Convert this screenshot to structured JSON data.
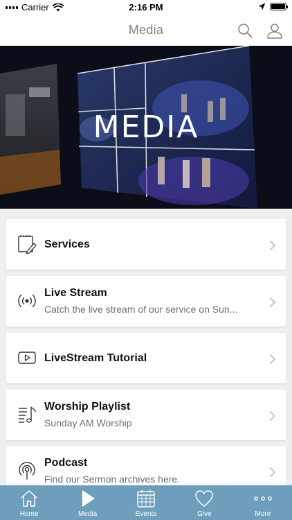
{
  "status_bar": {
    "carrier": "Carrier",
    "time": "2:16 PM"
  },
  "nav": {
    "title": "Media"
  },
  "hero": {
    "title": "MEDIA"
  },
  "items": [
    {
      "title": "Services",
      "subtitle": "",
      "icon": "notepad-edit-icon"
    },
    {
      "title": "Live Stream",
      "subtitle": "Catch the live stream of our service on Sun...",
      "icon": "broadcast-icon"
    },
    {
      "title": "LiveStream Tutorial",
      "subtitle": "",
      "icon": "video-play-icon"
    },
    {
      "title": "Worship Playlist",
      "subtitle": "Sunday AM Worship",
      "icon": "music-playlist-icon"
    },
    {
      "title": "Podcast",
      "subtitle": "Find our Sermon archives here.",
      "icon": "podcast-icon"
    }
  ],
  "tabs": [
    {
      "label": "Home",
      "icon": "home-icon"
    },
    {
      "label": "Media",
      "icon": "play-icon"
    },
    {
      "label": "Events",
      "icon": "calendar-icon"
    },
    {
      "label": "Give",
      "icon": "heart-icon"
    },
    {
      "label": "More",
      "icon": "more-icon"
    }
  ],
  "colors": {
    "nav_title": "#8a7f72",
    "tab_bar": "#6d9fbd",
    "background": "#efefef"
  }
}
